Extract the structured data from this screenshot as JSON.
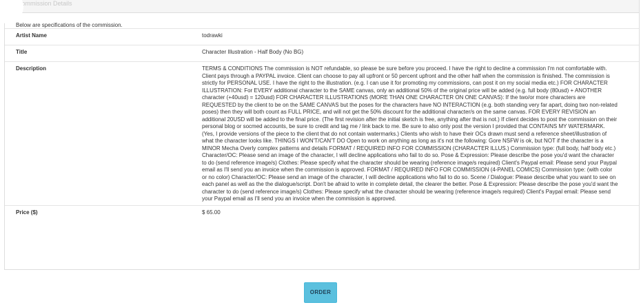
{
  "panel": {
    "heading": "Commission Details",
    "intro": "Below are specifications of the commission."
  },
  "specs": {
    "artist_label": "Artist Name",
    "artist_value": "todrawki",
    "title_label": "Title",
    "title_value": "Character Illustration - Half Body (No BG)",
    "description_label": "Description",
    "description_value": "TERMS & CONDITIONS The commission is NOT refundable, so please be sure before you proceed. I have the right to decline a commission I'm not comfortable with. Client pays through a PAYPAL invoice. Client can choose to pay all upfront or 50 percent upfront and the other half when the commission is finished. The commission is strictly for PERSONAL USE. I have the right to the illustration. (e.g. I can use it for promoting my commissions, can post it on my social media etc.) FOR CHARACTER ILLUSTRATION: For EVERY additional character to the SAME canvas, only an additional 50% of the original price will be added (e.g. full body (80usd) + ANOTHER character (+40usd) = 120usd) FOR CHARACTER ILLUSTRATIONS (MORE THAN ONE CHARACTER ON ONE CANVAS): If the two/or more characters are REQUESTED by the client to be on the SAME CANVAS but the poses for the characters have NO INTERACTION (e.g. both standing very far apart, doing two non-related poses) then they will both count as FULL PRICE, and will not get the 50% discount for the additional character/s on the same canvas. FOR EVERY REVISION an additional 20USD will be added to the final price. (The first revision after the initial sketch is free, anything after that is not.) If client decides to post the commission on their personal blog or socmed accounts, be sure to credit and tag me / link back to me. Be sure to also only post the version I provided that CONTAINS MY WATERMARK. (Yes, I provide versions of the piece to the client that do not contain watermarks.) Clients who wish to have their OCs drawn must send a reference sheet/illustration of what the character looks like. THINGS I WON'T/CAN'T DO Open to work on anything as long as it's not the following: Gore NSFW is ok, but NOT if the character is a MINOR Mecha Overly complex patterns and details FORMAT / REQUIRED INFO FOR COMMISSION (CHARACTER ILLUS.) Commission type: (full body, half body etc.) Character/OC: Please send an image of the character, I will decline applications who fail to do so. Pose & Expression: Please describe the pose you'd want the character to do (send reference image/s) Clothes: Please specify what the character should be wearing (reference image/s required) Client's Paypal email: Please send your Paypal email as I'll send you an invoice when the commission is approved. FORMAT / REQUIRED INFO FOR COMMISSION (4-PANEL COMICS) Commission type: (with color or no color) Character/OC: Please send an image of the character, I will decline applications who fail to do so. Scene / Dialogue: Please describe what you want to see on each panel as well as the the dialogue/script. Don't be afraid to write in complete detail, the clearer the better. Pose & Expression: Please describe the pose you'd want the character to do (send reference image/s) Clothes: Please specify what the character should be wearing (reference image/s required) Client's Paypal email: Please send your Paypal email as I'll send you an invoice when the commission is approved.",
    "price_label": "Price ($)",
    "price_value": "$ 65.00"
  },
  "actions": {
    "order_label": "ORDER"
  },
  "colors": {
    "accent": "#5bc0de",
    "border": "#dddddd",
    "heading_bg": "#f5f5f5"
  }
}
